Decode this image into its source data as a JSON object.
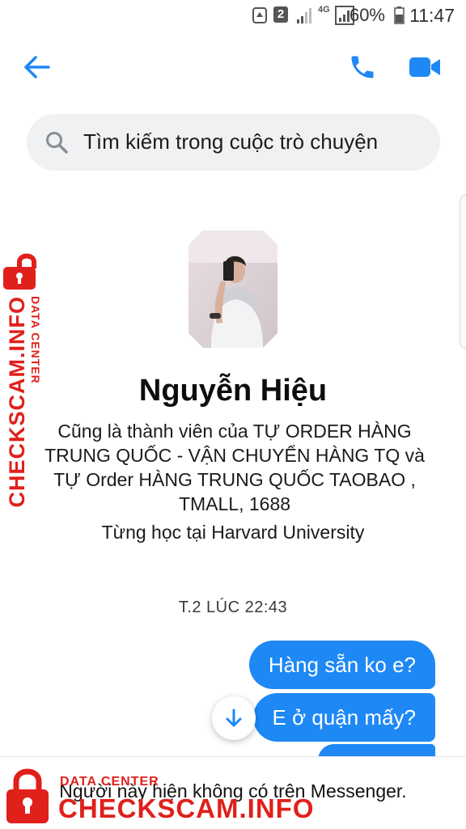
{
  "status_bar": {
    "sim_badge": "2",
    "network": "4G",
    "battery_percent": "60%",
    "time": "11:47"
  },
  "header": {
    "back_icon": "arrow-left-icon",
    "call_icon": "phone-icon",
    "video_icon": "video-camera-icon",
    "accent": "#1e88f5"
  },
  "search": {
    "placeholder": "Tìm kiếm trong cuộc trò chuyện"
  },
  "profile": {
    "name": "Nguyễn Hiệu",
    "bio": "Cũng là thành viên của TỰ ORDER HÀNG TRUNG QUỐC - VẬN CHUYỂN HÀNG TQ và TỰ Order HÀNG TRUNG QUỐC TAOBAO , TMALL, 1688",
    "education": "Từng học tại Harvard University"
  },
  "chat": {
    "timestamp": "T.2 LÚC 22:43",
    "messages": [
      {
        "text": "Hàng sẵn ko e?",
        "from": "me"
      },
      {
        "text": "E ở quận mấy?",
        "from": "me"
      },
      {
        "text": "",
        "from": "me"
      }
    ],
    "bubble_color": "#1e88f5"
  },
  "footer": {
    "notice": "Người này hiện không có trên Messenger."
  },
  "watermark": {
    "title": "CHECKSCAM.INFO",
    "subtitle": "DATA CENTER",
    "color": "#e0201b"
  }
}
